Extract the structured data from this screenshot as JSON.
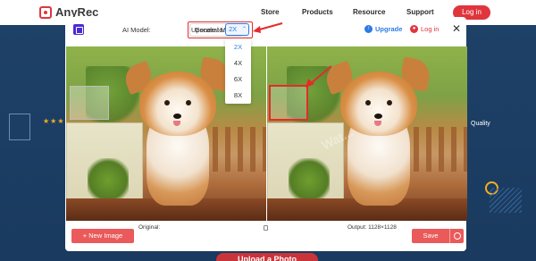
{
  "site": {
    "logo_text": "AnyRec",
    "nav": [
      "Store",
      "Products",
      "Resource",
      "Support"
    ],
    "login_label": "Log in",
    "quality_text": "Quality",
    "upload_label": "Upload a Photo"
  },
  "modal": {
    "ai_model_label": "AI Model:",
    "ai_model_value": "General Mode",
    "upscale_label": "Upscale to:",
    "upscale_value": "2X",
    "upscale_options": [
      "2X",
      "4X",
      "6X",
      "8X"
    ],
    "upgrade_label": "Upgrade",
    "login_label": "Log in",
    "close_label": "✕",
    "original_caption": "Original:",
    "output_caption": "Output: 1128×1128",
    "new_image_label": "+ New Image",
    "save_label": "Save",
    "watermark": "Wat..."
  },
  "colors": {
    "accent_red": "#e0353d",
    "accent_blue": "#2d7be5",
    "highlight_red": "#e52b2b"
  }
}
